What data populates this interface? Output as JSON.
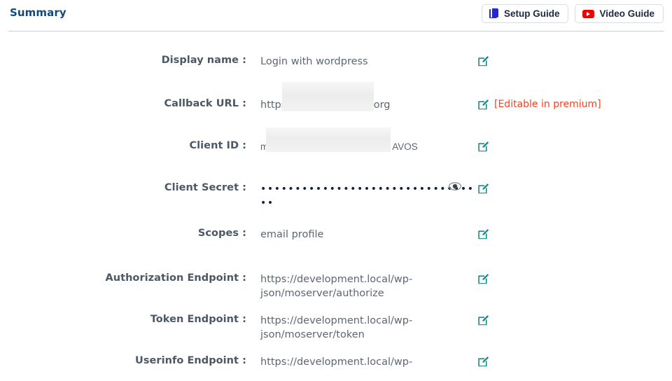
{
  "header": {
    "title": "Summary",
    "buttons": [
      {
        "label": "Setup Guide",
        "icon": "book-icon",
        "icon_color": "#2525e0"
      },
      {
        "label": "Video Guide",
        "icon": "youtube-play-icon",
        "icon_color": "#f00000"
      }
    ]
  },
  "colors": {
    "title": "#11497d",
    "label": "#4c5866",
    "value": "#5d6672",
    "edit_icon": "#1c8a8a",
    "premium_note": "#f5401f",
    "divider": "#c9ccd4"
  },
  "rows": [
    {
      "label": "Display name :",
      "value": "Login with wordpress",
      "action": "edit-icon",
      "redacted": false
    },
    {
      "label": "Callback URL :",
      "value_prefix": "https://",
      "value_suffix": "u1.wpsandbox.org",
      "action": "edit-icon",
      "note": "[Editable in premium]",
      "redacted": true
    },
    {
      "label": "Client ID :",
      "value_prefix": "mrtBN",
      "value_suffix": "AVOS",
      "action": "edit-icon",
      "redacted": true
    },
    {
      "label": "Client Secret :",
      "value": "•••••••••••••••••••••••••••••••••",
      "action": "edit-icon",
      "toggle": "eye-icon",
      "redacted": false
    },
    {
      "label": "Scopes :",
      "value": "email profile",
      "action": "edit-icon",
      "redacted": false
    },
    {
      "label": "Authorization Endpoint :",
      "value": "https://development.local/wp-json/moserver/authorize",
      "action": "edit-icon",
      "redacted": false
    },
    {
      "label": "Token Endpoint :",
      "value": "https://development.local/wp-json/moserver/token",
      "action": "edit-icon",
      "redacted": false
    },
    {
      "label": "Userinfo Endpoint :",
      "value": "https://development.local/wp-",
      "action": "edit-icon",
      "redacted": false
    }
  ]
}
